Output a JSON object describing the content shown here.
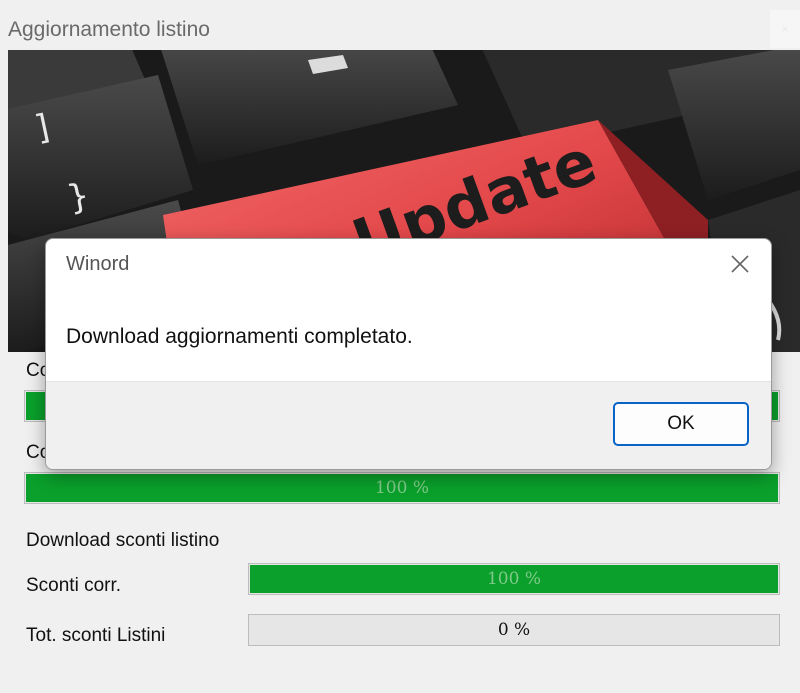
{
  "window": {
    "title": "Aggiornamento listino",
    "close_glyph": "×"
  },
  "banner": {
    "key_label": "Update",
    "icon": "keyboard-update-key-image"
  },
  "sections": {
    "hidden_label_1": "Co",
    "hidden_label_2": "Co",
    "download_heading": "Download sconti listino"
  },
  "progress": {
    "bar1": {
      "value": 1.0
    },
    "bar2": {
      "value": 1.0,
      "text": "100 %"
    },
    "sconti_corr": {
      "label": "Sconti corr.",
      "value": 1.0,
      "text": "100 %"
    },
    "tot_sconti": {
      "label": "Tot. sconti Listini",
      "value": 0.0,
      "text": "0 %"
    }
  },
  "dialog": {
    "title": "Winord",
    "message": "Download aggiornamenti completato.",
    "ok_label": "OK",
    "close_icon": "close-icon"
  },
  "colors": {
    "progress_green": "#0aa02b",
    "update_key_red": "#e3484a",
    "ok_border": "#0a64c8"
  }
}
